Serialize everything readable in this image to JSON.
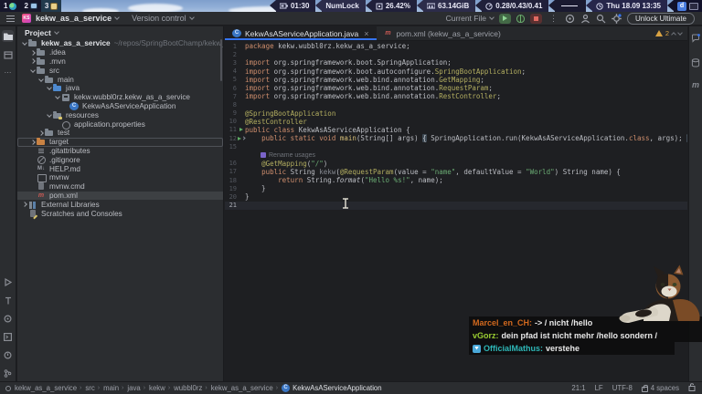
{
  "statusbar_top": {
    "workspaces": [
      {
        "label": "1",
        "icon": "globe"
      },
      {
        "label": "2",
        "icon": "monitor"
      },
      {
        "label": "3",
        "icon": "notes",
        "active": true
      }
    ],
    "battery": "01:30",
    "numlock": "NumLock",
    "cpu": "26.42%",
    "ram": "63.14GiB",
    "load": "0.28/0.43/0.41",
    "clock": "Thu 18.09 13:35",
    "tray_d": "d"
  },
  "titlebar": {
    "project_badge": "KS",
    "project_name": "kekw_as_a_service",
    "version_control": "Version control",
    "run_widget": "Current File",
    "unlock_label": "Unlock Ultimate"
  },
  "project_panel": {
    "header": "Project",
    "tree": [
      {
        "label": "kekw_as_a_service",
        "hint": "~/repos/SpringBootChamp/kekw_as_a_service",
        "icon": "ic-folder",
        "depth": 0,
        "chev": "d",
        "bold": true
      },
      {
        "label": ".idea",
        "icon": "ic-folder",
        "depth": 1,
        "chev": "r"
      },
      {
        "label": ".mvn",
        "icon": "ic-folder",
        "depth": 1,
        "chev": "r"
      },
      {
        "label": "src",
        "icon": "ic-folder",
        "depth": 1,
        "chev": "d"
      },
      {
        "label": "main",
        "icon": "ic-folder",
        "depth": 2,
        "chev": "d"
      },
      {
        "label": "java",
        "icon": "ic-folder-src",
        "depth": 3,
        "chev": "d"
      },
      {
        "label": "kekw.wubbl0rz.kekw_as_a_service",
        "icon": "ic-package",
        "depth": 4,
        "chev": "d"
      },
      {
        "label": "KekwAsAServiceApplication",
        "icon": "ic-class",
        "depth": 5
      },
      {
        "label": "resources",
        "icon": "ic-folder-res",
        "depth": 3,
        "chev": "d"
      },
      {
        "label": "application.properties",
        "icon": "ic-props",
        "depth": 4
      },
      {
        "label": "test",
        "icon": "ic-folder",
        "depth": 2,
        "chev": "r"
      },
      {
        "label": "target",
        "icon": "ic-folder-excl",
        "depth": 1,
        "chev": "r",
        "boxed": true
      },
      {
        "label": ".gitattributes",
        "icon": "ic-attrs",
        "depth": 1
      },
      {
        "label": ".gitignore",
        "icon": "ic-ignore",
        "depth": 1
      },
      {
        "label": "HELP.md",
        "icon": "ic-md",
        "depth": 1,
        "glyph": "M↓"
      },
      {
        "label": "mvnw",
        "icon": "ic-sh",
        "depth": 1
      },
      {
        "label": "mvnw.cmd",
        "icon": "ic-file",
        "depth": 1
      },
      {
        "label": "pom.xml",
        "icon": "ic-maven",
        "depth": 1,
        "glyph": "m",
        "selected": true
      },
      {
        "label": "External Libraries",
        "icon": "ic-libs",
        "depth": 0,
        "chev": "r"
      },
      {
        "label": "Scratches and Consoles",
        "icon": "ic-scratch",
        "depth": 0
      }
    ]
  },
  "editor": {
    "tabs": [
      {
        "label": "KekwAsAServiceApplication.java",
        "icon": "class",
        "close": "×",
        "active": true
      },
      {
        "label": "pom.xml (kekw_as_a_service)",
        "icon": "maven",
        "active": false
      }
    ],
    "warnings_count": "2",
    "hint_label": "Rename usages",
    "lines": [
      {
        "n": "1",
        "t": [
          [
            "kw",
            "package "
          ],
          [
            "pl",
            "kekw.wubbl0rz.kekw_as_a_service;"
          ]
        ]
      },
      {
        "n": "2",
        "t": []
      },
      {
        "n": "3",
        "t": [
          [
            "kw",
            "import "
          ],
          [
            "pl",
            "org.springframework.boot.SpringApplication;"
          ]
        ]
      },
      {
        "n": "4",
        "t": [
          [
            "kw",
            "import "
          ],
          [
            "pl",
            "org.springframework.boot.autoconfigure."
          ],
          [
            "ann",
            "SpringBootApplication"
          ],
          [
            "pl",
            ";"
          ]
        ]
      },
      {
        "n": "5",
        "t": [
          [
            "kw",
            "import "
          ],
          [
            "pl",
            "org.springframework.web.bind.annotation."
          ],
          [
            "ann",
            "GetMapping"
          ],
          [
            "pl",
            ";"
          ]
        ]
      },
      {
        "n": "6",
        "t": [
          [
            "kw",
            "import "
          ],
          [
            "pl",
            "org.springframework.web.bind.annotation."
          ],
          [
            "ann",
            "RequestParam"
          ],
          [
            "pl",
            ";"
          ]
        ]
      },
      {
        "n": "7",
        "t": [
          [
            "kw",
            "import "
          ],
          [
            "pl",
            "org.springframework.web.bind.annotation."
          ],
          [
            "ann",
            "RestController"
          ],
          [
            "pl",
            ";"
          ]
        ]
      },
      {
        "n": "8",
        "t": []
      },
      {
        "n": "9",
        "t": [
          [
            "ann",
            "@SpringBootApplication"
          ]
        ]
      },
      {
        "n": "10",
        "t": [
          [
            "ann",
            "@RestController"
          ]
        ]
      },
      {
        "n": "11",
        "run": true,
        "t": [
          [
            "kw",
            "public class "
          ],
          [
            "pl",
            "KekwAsAServiceApplication {"
          ]
        ]
      },
      {
        "n": "12",
        "run": true,
        "chev": true,
        "t": [
          [
            "pl",
            "    "
          ],
          [
            "kw",
            "public static void "
          ],
          [
            "mth",
            "main"
          ],
          [
            "pl",
            "(String[] args) "
          ],
          [
            "fold",
            "{"
          ],
          [
            "pl",
            " SpringApplication.run(KekwAsAServiceApplication."
          ],
          [
            "kw",
            "class"
          ],
          [
            "pl",
            ", args); "
          ],
          [
            "fold",
            "}"
          ]
        ]
      },
      {
        "n": "15",
        "t": []
      },
      {
        "n": "",
        "hint": true
      },
      {
        "n": "16",
        "t": [
          [
            "pl",
            "    "
          ],
          [
            "ann",
            "@GetMapping"
          ],
          [
            "pl",
            "("
          ],
          [
            "str",
            "\"/\""
          ],
          [
            "pl",
            ")"
          ]
        ]
      },
      {
        "n": "17",
        "t": [
          [
            "pl",
            "    "
          ],
          [
            "kw",
            "public "
          ],
          [
            "pl",
            "String "
          ],
          [
            "gray",
            "kekw"
          ],
          [
            "pl",
            "("
          ],
          [
            "ann",
            "@RequestParam"
          ],
          [
            "pl",
            "(value = "
          ],
          [
            "str",
            "\"name\""
          ],
          [
            "pl",
            ", defaultValue = "
          ],
          [
            "str",
            "\"World\""
          ],
          [
            "pl",
            ") String name) {"
          ]
        ]
      },
      {
        "n": "18",
        "t": [
          [
            "pl",
            "        "
          ],
          [
            "kw",
            "return "
          ],
          [
            "pl",
            "String."
          ],
          [
            "it",
            "format"
          ],
          [
            "pl",
            "("
          ],
          [
            "str",
            "\"Hello %s!\""
          ],
          [
            "pl",
            ", name);"
          ]
        ]
      },
      {
        "n": "19",
        "t": [
          [
            "pl",
            "    }"
          ]
        ]
      },
      {
        "n": "20",
        "t": [
          [
            "pl",
            "}"
          ]
        ]
      },
      {
        "n": "21",
        "caret": true,
        "t": []
      }
    ]
  },
  "breadcrumbs": [
    "kekw_as_a_service",
    "src",
    "main",
    "java",
    "kekw",
    "wubbl0rz",
    "kekw_as_a_service",
    "KekwAsAServiceApplication"
  ],
  "statusbar_bottom": {
    "position": "21:1",
    "line_separator": "LF",
    "encoding": "UTF-8",
    "indent": "4 spaces"
  },
  "chat": {
    "messages": [
      {
        "user": "Marcel_en_CH",
        "color": "#d2691e",
        "text": "-> / nicht /hello"
      },
      {
        "user": "vGorz",
        "color": "#9acd32",
        "text": "dein pfad ist nicht mehr /hello sondern /"
      },
      {
        "user": "OfficialMathus",
        "color": "#2eb8b8",
        "text": "verstehe",
        "badge": true
      }
    ]
  }
}
